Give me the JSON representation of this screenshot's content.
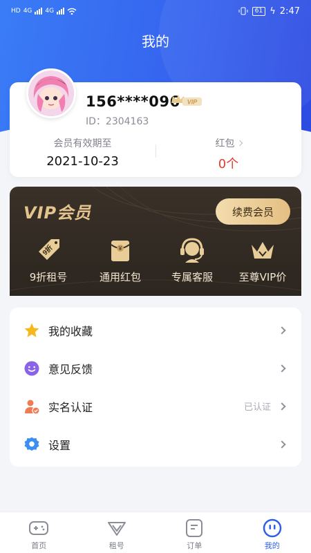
{
  "status_bar": {
    "left": [
      "HD",
      "4G",
      "4G"
    ],
    "battery": "61",
    "time": "2:47"
  },
  "page_title": "我的",
  "profile": {
    "phone": "156****096",
    "vip_badge": "VIP",
    "id_text": "ID：2304163",
    "membership_label": "会员有效期至",
    "membership_date": "2021-10-23",
    "redpacket_label": "红包",
    "redpacket_value": "0个"
  },
  "vip": {
    "title": "VIP会员",
    "renew_label": "续费会员",
    "perks": [
      {
        "label": "9折租号",
        "icon": "discount-tag-icon",
        "badge": "9折"
      },
      {
        "label": "通用红包",
        "icon": "red-packet-icon",
        "badge": "¥"
      },
      {
        "label": "专属客服",
        "icon": "headset-icon"
      },
      {
        "label": "至尊VIP价",
        "icon": "crown-icon"
      }
    ]
  },
  "menu": [
    {
      "label": "我的收藏",
      "icon": "star-icon",
      "badge": ""
    },
    {
      "label": "意见反馈",
      "icon": "smiley-icon",
      "badge": ""
    },
    {
      "label": "实名认证",
      "icon": "verified-user-icon",
      "badge": "已认证"
    },
    {
      "label": "设置",
      "icon": "gear-icon",
      "badge": ""
    }
  ],
  "tabs": [
    {
      "label": "首页",
      "icon": "gamepad-icon",
      "active": false
    },
    {
      "label": "租号",
      "icon": "chevron-heart-icon",
      "active": false
    },
    {
      "label": "订单",
      "icon": "order-icon",
      "active": false
    },
    {
      "label": "我的",
      "icon": "profile-face-icon",
      "active": true
    }
  ],
  "colors": {
    "brand_blue": "#3562ee",
    "vip_gold": "#e3c48e",
    "alert_red": "#e23b2e",
    "tab_active": "#2e5fe8"
  }
}
